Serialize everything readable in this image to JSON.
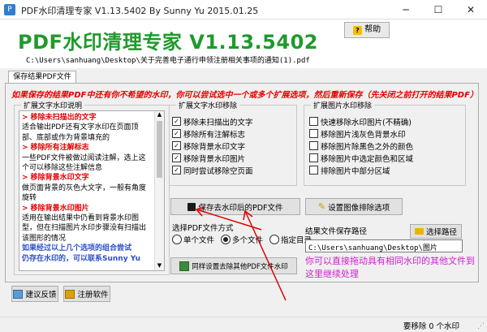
{
  "window": {
    "title": "PDF水印清理专家 V1.13.5402 By Sunny Yu 2015.01.25",
    "minimize": "─",
    "maximize": "☐",
    "close": "✕"
  },
  "header": {
    "heading": "PDF水印清理专家 V1.13.5402",
    "help_label": "帮助",
    "file_path": "C:\\Users\\sanhuang\\Desktop\\关于完善电子通行申领注册相关事项的通知(1).pdf"
  },
  "tab": {
    "label": "保存结果PDF文件"
  },
  "notice": "如果保存的结果PDF中还有你不希望的水印，你可以尝试选中一个或多个扩展选项，然后重新保存（先关闭之前打开的结果PDF）",
  "desc_panel": {
    "title": "扩展文字水印说明",
    "lines": [
      {
        "t": "> 移除未扫描出的文字",
        "k": "h"
      },
      {
        "t": "  适合输出PDF还有文字水印在页面顶",
        "k": "t"
      },
      {
        "t": "部、底部或作为背景填充的",
        "k": "t"
      },
      {
        "t": "> 移除所有注解标志",
        "k": "h"
      },
      {
        "t": "  一些PDF文件被做过阅读注解，选上这",
        "k": "t"
      },
      {
        "t": "个可以移除这些注解信息",
        "k": "t"
      },
      {
        "t": "> 移除背景水印文字",
        "k": "h"
      },
      {
        "t": "  做页面背景的灰色大文字，一般有角度",
        "k": "t"
      },
      {
        "t": "旋转",
        "k": "t"
      },
      {
        "t": "> 移除背景水印图片",
        "k": "h"
      },
      {
        "t": "  适用在输出结果中仍看到背景水印图",
        "k": "t"
      },
      {
        "t": "型，但在扫描图片水印步骤没有扫描出",
        "k": "t"
      },
      {
        "t": "该图形的情况",
        "k": "t"
      },
      {
        "t": "如果经过以上几个选项的组合尝试",
        "k": "f"
      },
      {
        "t": "仍存在水印的，可以联系Sunny Yu",
        "k": "f"
      }
    ]
  },
  "text_group": {
    "title": "扩展文字水印移除",
    "options": [
      {
        "label": "移除未扫描出的文字",
        "checked": true
      },
      {
        "label": "移除所有注解标志",
        "checked": true
      },
      {
        "label": "移除背景水印文字",
        "checked": true
      },
      {
        "label": "移除背景水印图片",
        "checked": true
      },
      {
        "label": "同时尝试移除空页面",
        "checked": true
      }
    ]
  },
  "image_group": {
    "title": "扩展图片水印移除",
    "options": [
      {
        "label": "快速移除水印图片(不精确)",
        "checked": false
      },
      {
        "label": "移除图片浅灰色背景水印",
        "checked": false
      },
      {
        "label": "移除图片除黑色之外的颜色",
        "checked": false
      },
      {
        "label": "移除图片中选定颜色和区域",
        "checked": false
      },
      {
        "label": "排除图片中部分区域",
        "checked": false
      }
    ]
  },
  "buttons": {
    "save": "保存去水印后的PDF文件",
    "image_options": "设置图像排除选项",
    "apply_others": "同样设置去除其他PDF文件水印",
    "choose_path": "选择路径",
    "feedback": "建议反馈",
    "register": "注册软件"
  },
  "file_mode": {
    "title": "选择PDF文件方式",
    "options": [
      {
        "label": "单个文件",
        "selected": false
      },
      {
        "label": "多个文件",
        "selected": true
      },
      {
        "label": "指定目录",
        "selected": false
      }
    ]
  },
  "save_path": {
    "label": "结果文件保存路径",
    "value": "C:\\Users\\sanhuang\\Desktop\\图片"
  },
  "hint": "你可以直接拖动具有相同水印的其他文件到这里继续处理",
  "status": {
    "text": "要移除 0 个水印"
  },
  "colors": {
    "accent_green": "#1f9a2c",
    "notice_red": "#e60000",
    "hint_magenta": "#d020d0",
    "arrow_red": "#e00000"
  }
}
